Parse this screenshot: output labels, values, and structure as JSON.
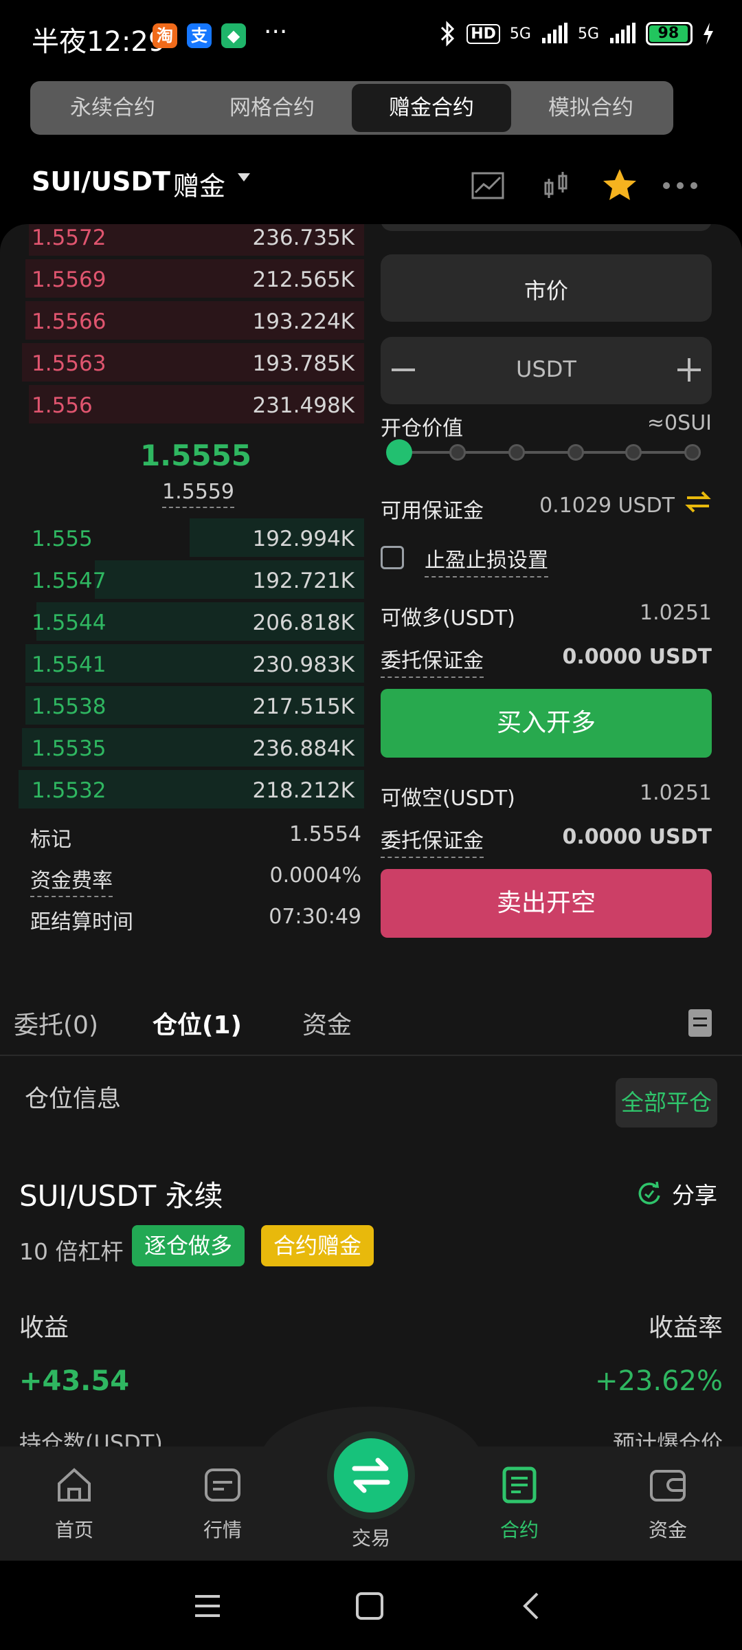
{
  "status": {
    "time": "半夜12:29",
    "battery": "98",
    "network": "5G",
    "hd": "HD",
    "apps": [
      "淘",
      "支",
      "◆"
    ],
    "more": "···"
  },
  "top_tabs": [
    {
      "label": "永续合约",
      "active": false
    },
    {
      "label": "网格合约",
      "active": false
    },
    {
      "label": "赠金合约",
      "active": true
    },
    {
      "label": "模拟合约",
      "active": false
    }
  ],
  "pair": {
    "name": "SUI/USDT",
    "tag": "赠金"
  },
  "orderbook": {
    "asks": [
      {
        "price": "1.5572",
        "qty": "236.735K",
        "depth": 0.92
      },
      {
        "price": "1.5569",
        "qty": "212.565K",
        "depth": 0.93
      },
      {
        "price": "1.5566",
        "qty": "193.224K",
        "depth": 0.93
      },
      {
        "price": "1.5563",
        "qty": "193.785K",
        "depth": 0.94
      },
      {
        "price": "1.556",
        "qty": "231.498K",
        "depth": 0.92
      }
    ],
    "last_price": "1.5555",
    "mark_price": "1.5559",
    "bids": [
      {
        "price": "1.555",
        "qty": "192.994K",
        "depth": 0.48
      },
      {
        "price": "1.5547",
        "qty": "192.721K",
        "depth": 0.74
      },
      {
        "price": "1.5544",
        "qty": "206.818K",
        "depth": 0.9
      },
      {
        "price": "1.5541",
        "qty": "230.983K",
        "depth": 0.93
      },
      {
        "price": "1.5538",
        "qty": "217.515K",
        "depth": 0.93
      },
      {
        "price": "1.5535",
        "qty": "236.884K",
        "depth": 0.94
      },
      {
        "price": "1.5532",
        "qty": "218.212K",
        "depth": 0.95
      }
    ]
  },
  "market_info": {
    "mark_label": "标记",
    "mark_value": "1.5554",
    "funding_label": "资金费率",
    "funding_value": "0.0004%",
    "settle_label": "距结算时间",
    "settle_value": "07:30:49"
  },
  "form": {
    "order_type": "市价",
    "amount_unit": "USDT",
    "open_value_label": "开仓价值",
    "open_value": "≈0SUI",
    "leverage_fraction": 0,
    "avail_margin_label": "可用保证金",
    "avail_margin": "0.1029 USDT",
    "tpsl_label": "止盈止损设置",
    "long_max_label": "可做多(USDT)",
    "long_max": "1.0251",
    "order_margin_label": "委托保证金",
    "order_margin_long": "0.0000 USDT",
    "buy_label": "买入开多",
    "short_max_label": "可做空(USDT)",
    "short_max": "1.0251",
    "order_margin_short": "0.0000 USDT",
    "sell_label": "卖出开空"
  },
  "position_tabs": [
    {
      "label": "委托(0)",
      "active": false
    },
    {
      "label": "仓位(1)",
      "active": true
    },
    {
      "label": "资金",
      "active": false
    }
  ],
  "position": {
    "section_title": "仓位信息",
    "close_all": "全部平仓",
    "pair": "SUI/USDT 永续",
    "share": "分享",
    "leverage": "10 倍杠杆",
    "tag_mode": "逐仓做多",
    "tag_bonus": "合约赠金",
    "pnl_label": "收益",
    "pnl": "+43.54",
    "roe_label": "收益率",
    "roe": "+23.62%",
    "size_label": "持仓数(USDT)",
    "liq_label": "预计爆仓价"
  },
  "nav": [
    {
      "label": "首页",
      "icon": "home-icon"
    },
    {
      "label": "行情",
      "icon": "market-icon"
    },
    {
      "label": "交易",
      "icon": "swap-icon"
    },
    {
      "label": "合约",
      "icon": "contract-icon",
      "active": true
    },
    {
      "label": "资金",
      "icon": "wallet-icon"
    }
  ],
  "colors": {
    "green": "#2fb761",
    "red": "#e0556f",
    "accent": "#17c27b",
    "yellow": "#e8b90c"
  }
}
